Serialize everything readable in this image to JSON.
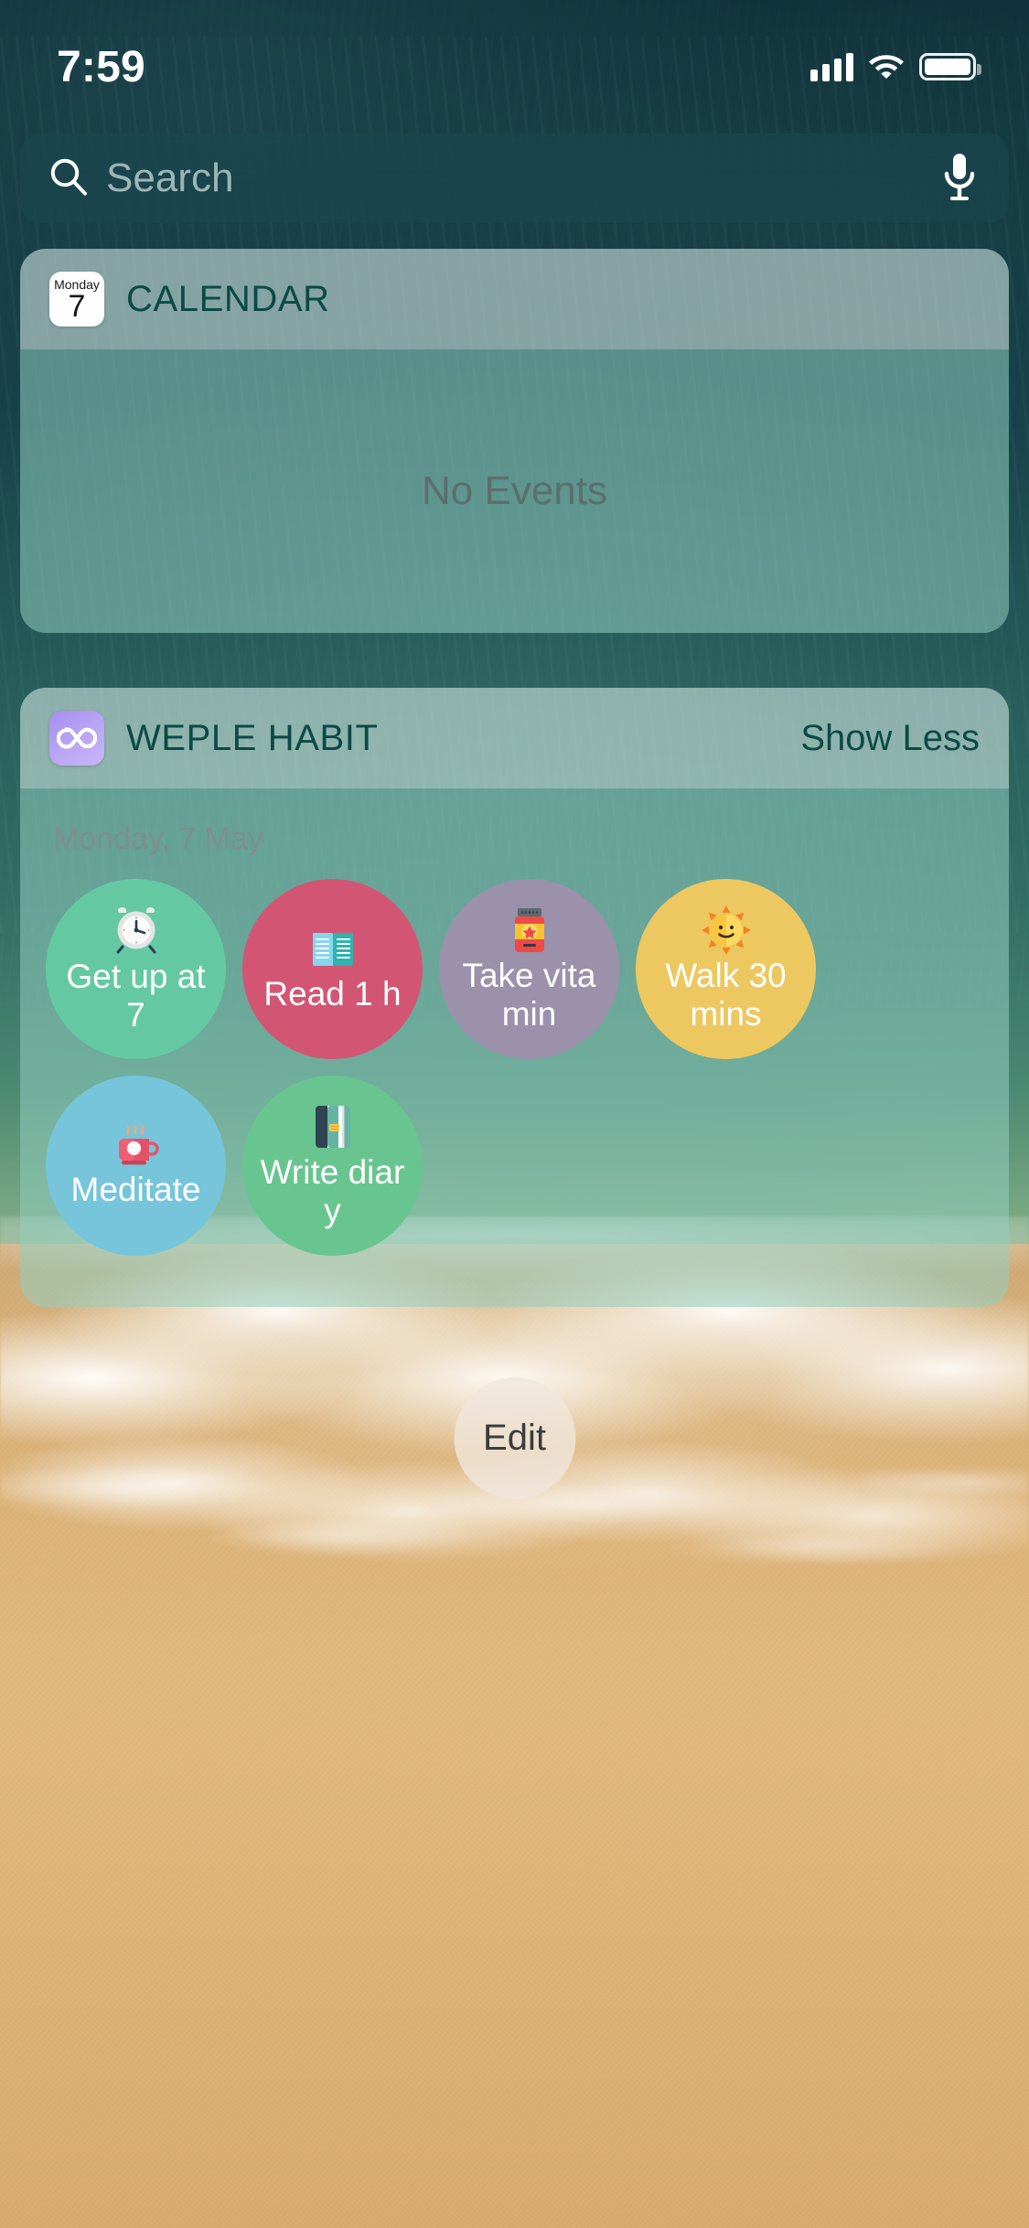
{
  "status_bar": {
    "time": "7:59",
    "signal_icon": "cellular-bars-icon",
    "wifi_icon": "wifi-icon",
    "battery_icon": "battery-full-icon"
  },
  "search": {
    "placeholder": "Search",
    "value": "",
    "search_icon": "search-icon",
    "mic_icon": "microphone-icon"
  },
  "widgets": [
    {
      "id": "calendar",
      "app_icon": "calendar-app-icon",
      "icon_day_of_week": "Monday",
      "icon_day_number": "7",
      "title": "CALENDAR",
      "action_label": "",
      "empty_state": "No Events"
    },
    {
      "id": "weple_habit",
      "app_icon": "weple-habit-app-icon",
      "icon_glyph": "infinity-icon",
      "title": "WEPLE HABIT",
      "action_label": "Show Less",
      "date_line": "Monday, 7 May",
      "habits": [
        {
          "label": "Get up at 7",
          "emoji": "alarm-clock-icon",
          "color": "#64c9a3"
        },
        {
          "label": "Read 1 h",
          "emoji": "open-book-icon",
          "color": "#d25674"
        },
        {
          "label": "Take vitamin",
          "emoji": "vitamin-jar-icon",
          "color": "#9b91ab"
        },
        {
          "label": "Walk 30 mins",
          "emoji": "sun-smile-icon",
          "color": "#edc75f"
        },
        {
          "label": "Meditate",
          "emoji": "hot-beverage-icon",
          "color": "#76c5da"
        },
        {
          "label": "Write diary",
          "emoji": "notebook-icon",
          "color": "#69c58f"
        }
      ]
    }
  ],
  "edit_button": {
    "label": "Edit"
  },
  "theme": {
    "widget_title_color": "#0b4a45",
    "widget_header_bg": "rgba(214,235,230,0.58)",
    "widget_body_bg": "rgba(146,205,192,0.55)",
    "empty_text_color": "#5b6f6c",
    "date_text_color": "#7e8f8b"
  }
}
